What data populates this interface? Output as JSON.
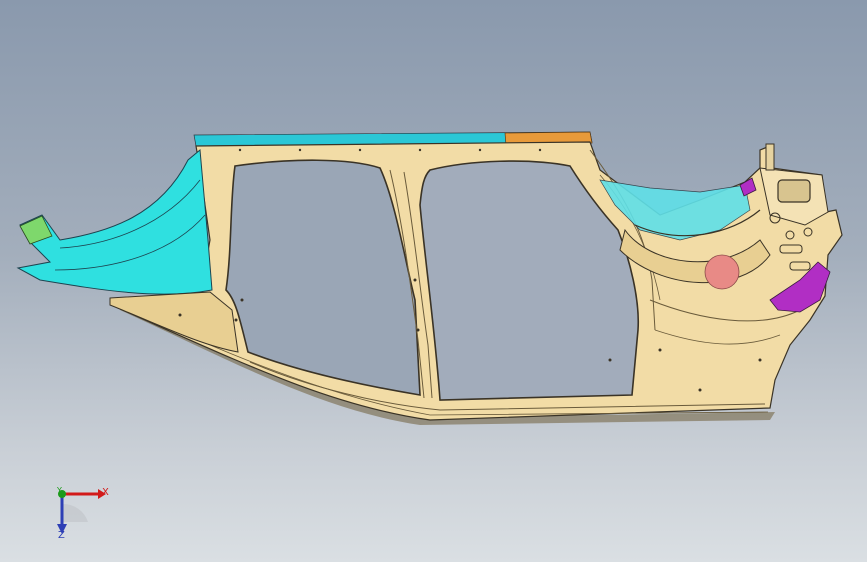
{
  "viewport": {
    "background_top": "#8a99ad",
    "background_bottom": "#dadfe3"
  },
  "model": {
    "main_color": "#f2dca6",
    "outline_color": "#3a3326",
    "wheelarch_color": "#2fe0e0",
    "bracket_color": "#b12ec4",
    "roofstrip_color": "#2bc7d6",
    "accent_orange": "#e89a3a",
    "marker_color": "#e88a86"
  },
  "triad": {
    "x_label": "X",
    "y_label": "Y",
    "z_label": "Z",
    "x_color": "#d21a1a",
    "y_color": "#1c9a1c",
    "z_color": "#2d3fb5"
  }
}
